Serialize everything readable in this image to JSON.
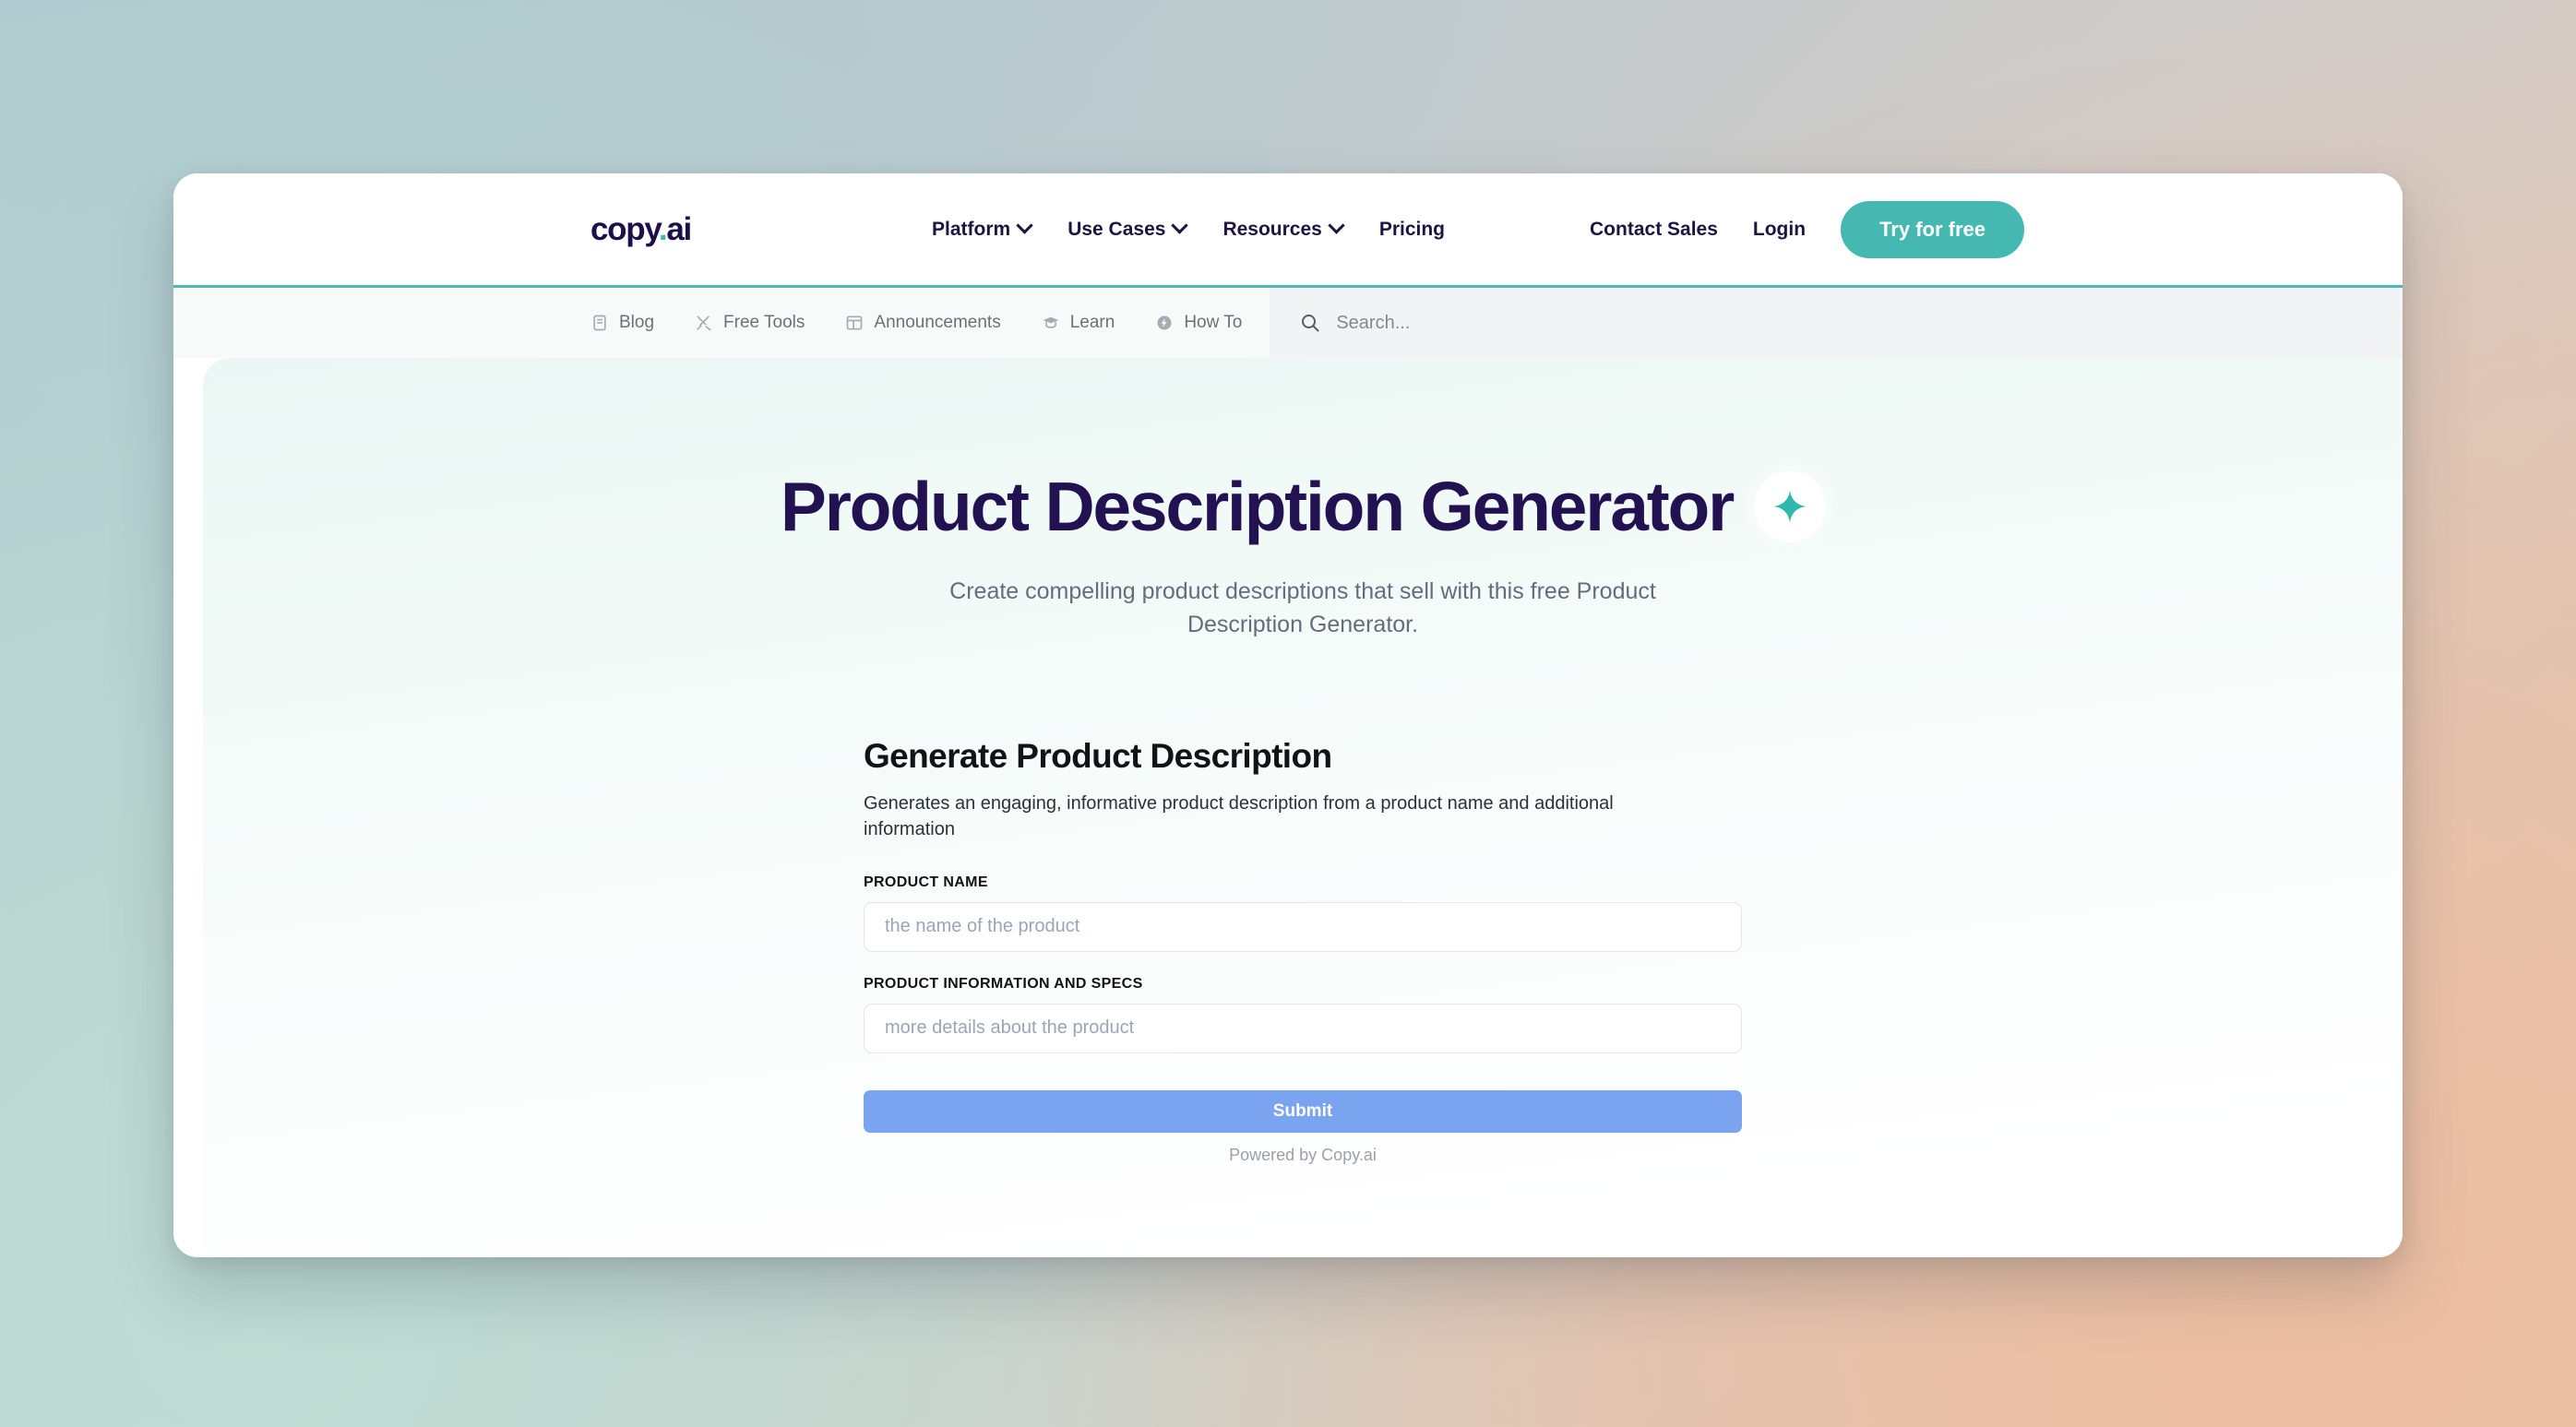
{
  "browser": {
    "primary_nav": {
      "logo": {
        "main": "copy",
        "dot": ".",
        "suffix": "ai"
      },
      "links": [
        {
          "label": "Platform",
          "has_chevron": true,
          "icon": "chevron-down-icon"
        },
        {
          "label": "Use Cases",
          "has_chevron": true,
          "icon": "chevron-down-icon"
        },
        {
          "label": "Resources",
          "has_chevron": true,
          "icon": "chevron-down-icon"
        },
        {
          "label": "Pricing",
          "has_chevron": false,
          "icon": ""
        }
      ],
      "contact_sales_label": "Contact Sales",
      "login_label": "Login",
      "cta_label": "Try for free",
      "accent_color": "#45b8b2",
      "logo_color": "#1d0f49"
    },
    "secondary_nav": {
      "items": [
        {
          "label": "Blog",
          "icon": "book-icon"
        },
        {
          "label": "Free Tools",
          "icon": "tools-icon"
        },
        {
          "label": "Announcements",
          "icon": "layout-icon"
        },
        {
          "label": "Learn",
          "icon": "graduation-cap-icon"
        },
        {
          "label": "How To",
          "icon": "lightning-circle-icon"
        }
      ],
      "search": {
        "placeholder": "Search...",
        "value": "",
        "icon": "search-icon"
      }
    }
  },
  "hero": {
    "title": "Product Description Generator",
    "sparkle_icon": "sparkle-icon",
    "sparkle_color": "#2fb8ad",
    "subtitle": "Create compelling product descriptions that sell with this free Product Description Generator."
  },
  "tool_form": {
    "title": "Generate Product Description",
    "description": "Generates an engaging, informative product description from a product name and additional information",
    "fields": [
      {
        "label": "PRODUCT NAME",
        "placeholder": "the name of the product",
        "value": ""
      },
      {
        "label": "PRODUCT INFORMATION AND SPECS",
        "placeholder": "more details about the product",
        "value": ""
      }
    ],
    "submit_label": "Submit",
    "submit_color": "#7aa4ef",
    "powered_by": "Powered by Copy.ai"
  }
}
